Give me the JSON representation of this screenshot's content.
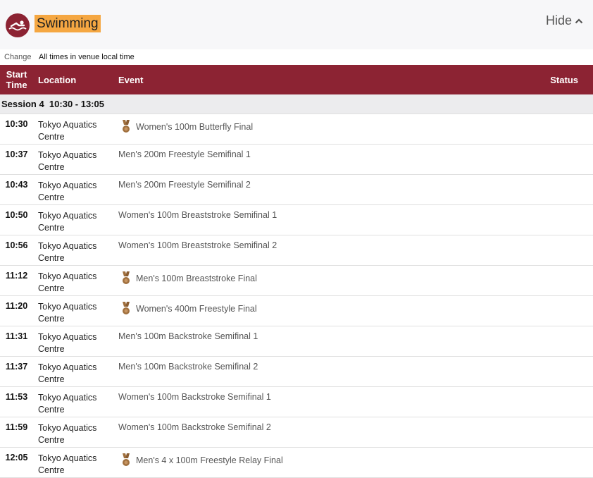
{
  "header": {
    "sport": "Swimming",
    "hide_label": "Hide",
    "sport_icon": "swimmer-icon",
    "hide_icon": "chevron-up-icon"
  },
  "subbar": {
    "change_label": "Change",
    "timezone_note": "All times in venue local time"
  },
  "table": {
    "columns": {
      "start_time_line1": "Start",
      "start_time_line2": "Time",
      "location": "Location",
      "event": "Event",
      "status": "Status"
    },
    "session": "Session 4  10:30 - 13:05",
    "rows": [
      {
        "time": "10:30",
        "location": "Tokyo Aquatics Centre",
        "event": "Women's 100m Butterfly Final",
        "medal": true
      },
      {
        "time": "10:37",
        "location": "Tokyo Aquatics Centre",
        "event": "Men's 200m Freestyle Semifinal 1",
        "medal": false
      },
      {
        "time": "10:43",
        "location": "Tokyo Aquatics Centre",
        "event": "Men's 200m Freestyle Semifinal 2",
        "medal": false
      },
      {
        "time": "10:50",
        "location": "Tokyo Aquatics Centre",
        "event": "Women's 100m Breaststroke Semifinal 1",
        "medal": false
      },
      {
        "time": "10:56",
        "location": "Tokyo Aquatics Centre",
        "event": "Women's 100m Breaststroke Semifinal 2",
        "medal": false
      },
      {
        "time": "11:12",
        "location": "Tokyo Aquatics Centre",
        "event": "Men's 100m Breaststroke Final",
        "medal": true
      },
      {
        "time": "11:20",
        "location": "Tokyo Aquatics Centre",
        "event": "Women's 400m Freestyle Final",
        "medal": true
      },
      {
        "time": "11:31",
        "location": "Tokyo Aquatics Centre",
        "event": "Men's 100m Backstroke Semifinal 1",
        "medal": false
      },
      {
        "time": "11:37",
        "location": "Tokyo Aquatics Centre",
        "event": "Men's 100m Backstroke Semifinal 2",
        "medal": false
      },
      {
        "time": "11:53",
        "location": "Tokyo Aquatics Centre",
        "event": "Women's 100m Backstroke Semifinal 1",
        "medal": false
      },
      {
        "time": "11:59",
        "location": "Tokyo Aquatics Centre",
        "event": "Women's 100m Backstroke Semifinal 2",
        "medal": false
      },
      {
        "time": "12:05",
        "location": "Tokyo Aquatics Centre",
        "event": "Men's 4 x 100m Freestyle Relay Final",
        "medal": true
      }
    ]
  },
  "colors": {
    "brand": "#8c2333",
    "highlight": "#f5a742",
    "medal": "#a0703e"
  }
}
